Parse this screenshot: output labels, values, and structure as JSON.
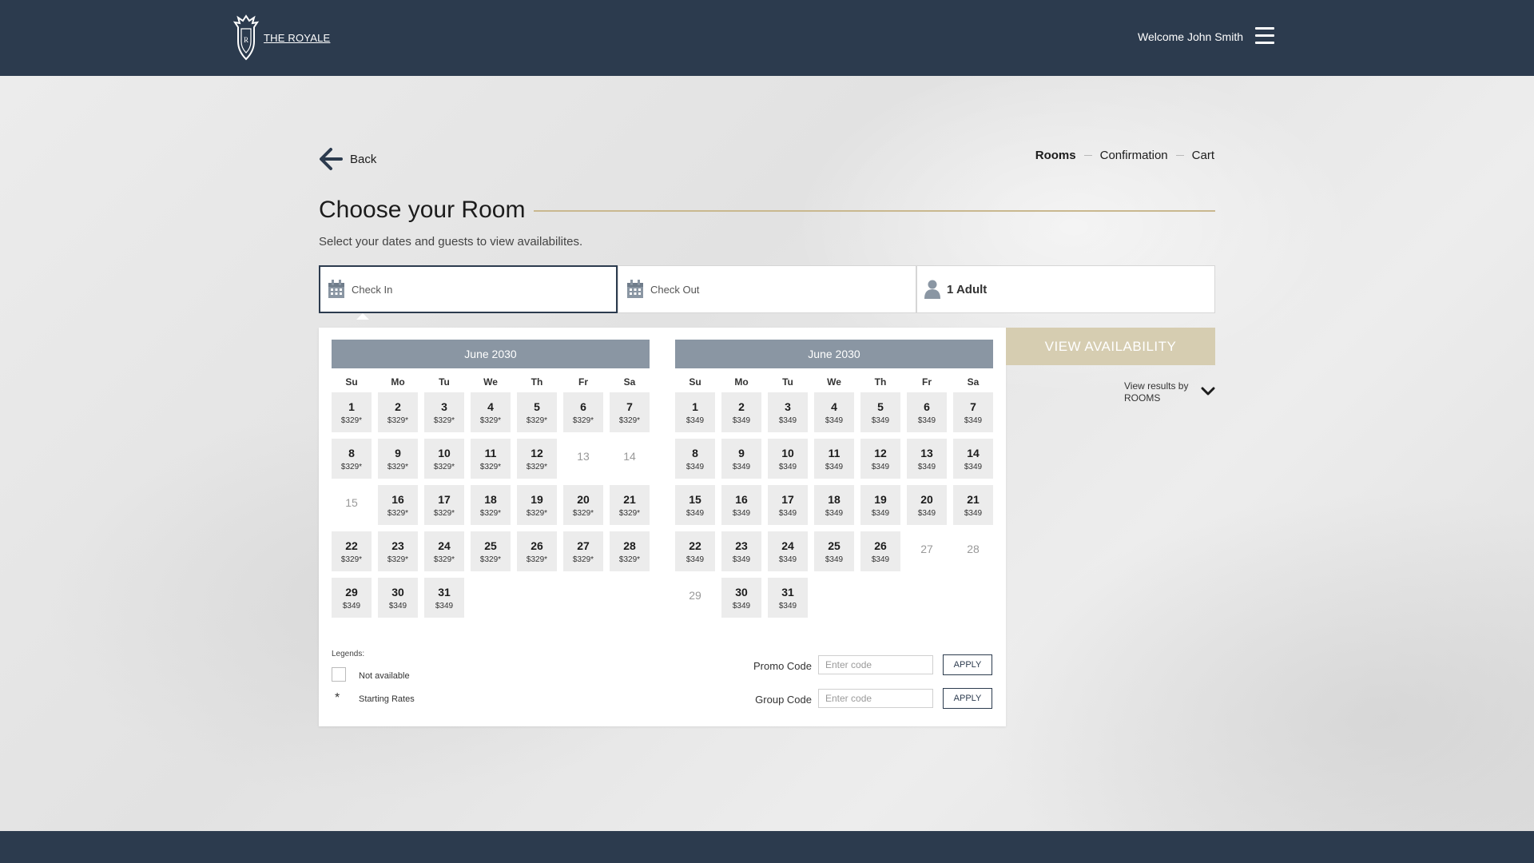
{
  "header": {
    "logo_text": "THE ROYALE",
    "logo_monogram": "R",
    "welcome": "Welcome John Smith",
    "menu_icon": "hamburger-icon"
  },
  "nav": {
    "back_label": "Back",
    "steps": [
      "Rooms",
      "Confirmation",
      "Cart"
    ],
    "active_step": "Rooms"
  },
  "page": {
    "title": "Choose your Room",
    "subtitle": "Select your dates and guests to view availabilites."
  },
  "search": {
    "check_in_label": "Check In",
    "check_out_label": "Check Out",
    "guests": "1 Adult"
  },
  "calendars": [
    {
      "title": "June 2030",
      "weekdays": [
        "Su",
        "Mo",
        "Tu",
        "We",
        "Th",
        "Fr",
        "Sa"
      ],
      "start_offset": 0,
      "days": [
        {
          "d": "1",
          "p": "$329*"
        },
        {
          "d": "2",
          "p": "$329*"
        },
        {
          "d": "3",
          "p": "$329*"
        },
        {
          "d": "4",
          "p": "$329*"
        },
        {
          "d": "5",
          "p": "$329*"
        },
        {
          "d": "6",
          "p": "$329*"
        },
        {
          "d": "7",
          "p": "$329*"
        },
        {
          "d": "8",
          "p": "$329*"
        },
        {
          "d": "9",
          "p": "$329*"
        },
        {
          "d": "10",
          "p": "$329*"
        },
        {
          "d": "11",
          "p": "$329*"
        },
        {
          "d": "12",
          "p": "$329*"
        },
        {
          "d": "13",
          "p": "",
          "na": true
        },
        {
          "d": "14",
          "p": "",
          "na": true
        },
        {
          "d": "15",
          "p": "",
          "na": true
        },
        {
          "d": "16",
          "p": "$329*"
        },
        {
          "d": "17",
          "p": "$329*"
        },
        {
          "d": "18",
          "p": "$329*"
        },
        {
          "d": "19",
          "p": "$329*"
        },
        {
          "d": "20",
          "p": "$329*"
        },
        {
          "d": "21",
          "p": "$329*"
        },
        {
          "d": "22",
          "p": "$329*"
        },
        {
          "d": "23",
          "p": "$329*"
        },
        {
          "d": "24",
          "p": "$329*"
        },
        {
          "d": "25",
          "p": "$329*"
        },
        {
          "d": "26",
          "p": "$329*"
        },
        {
          "d": "27",
          "p": "$329*"
        },
        {
          "d": "28",
          "p": "$329*"
        },
        {
          "d": "29",
          "p": "$349"
        },
        {
          "d": "30",
          "p": "$349"
        },
        {
          "d": "31",
          "p": "$349"
        }
      ]
    },
    {
      "title": "June 2030",
      "weekdays": [
        "Su",
        "Mo",
        "Tu",
        "We",
        "Th",
        "Fr",
        "Sa"
      ],
      "start_offset": 0,
      "days": [
        {
          "d": "1",
          "p": "$349"
        },
        {
          "d": "2",
          "p": "$349"
        },
        {
          "d": "3",
          "p": "$349"
        },
        {
          "d": "4",
          "p": "$349"
        },
        {
          "d": "5",
          "p": "$349"
        },
        {
          "d": "6",
          "p": "$349"
        },
        {
          "d": "7",
          "p": "$349"
        },
        {
          "d": "8",
          "p": "$349"
        },
        {
          "d": "9",
          "p": "$349"
        },
        {
          "d": "10",
          "p": "$349"
        },
        {
          "d": "11",
          "p": "$349"
        },
        {
          "d": "12",
          "p": "$349"
        },
        {
          "d": "13",
          "p": "$349"
        },
        {
          "d": "14",
          "p": "$349"
        },
        {
          "d": "15",
          "p": "$349"
        },
        {
          "d": "16",
          "p": "$349"
        },
        {
          "d": "17",
          "p": "$349"
        },
        {
          "d": "18",
          "p": "$349"
        },
        {
          "d": "19",
          "p": "$349"
        },
        {
          "d": "20",
          "p": "$349"
        },
        {
          "d": "21",
          "p": "$349"
        },
        {
          "d": "22",
          "p": "$349"
        },
        {
          "d": "23",
          "p": "$349"
        },
        {
          "d": "24",
          "p": "$349"
        },
        {
          "d": "25",
          "p": "$349"
        },
        {
          "d": "26",
          "p": "$349"
        },
        {
          "d": "27",
          "p": "",
          "na": true
        },
        {
          "d": "28",
          "p": "",
          "na": true
        },
        {
          "d": "29",
          "p": "",
          "na": true
        },
        {
          "d": "30",
          "p": "$349"
        },
        {
          "d": "31",
          "p": "$349"
        }
      ]
    }
  ],
  "legend": {
    "title": "Legends:",
    "not_available": "Not available",
    "star": "*",
    "starting_rates": "Starting Rates"
  },
  "codes": {
    "promo_label": "Promo Code",
    "group_label": "Group Code",
    "placeholder": "Enter code",
    "apply": "APPLY"
  },
  "actions": {
    "view_availability": "VIEW AVAILABILITY",
    "view_results_by": "View results by",
    "view_results_mode": "ROOMS"
  },
  "colors": {
    "header_bg": "#2c3b4e",
    "accent_gold": "#c9b88f",
    "button_gold": "#d6cdb1",
    "calendar_head": "#8a96a3"
  }
}
